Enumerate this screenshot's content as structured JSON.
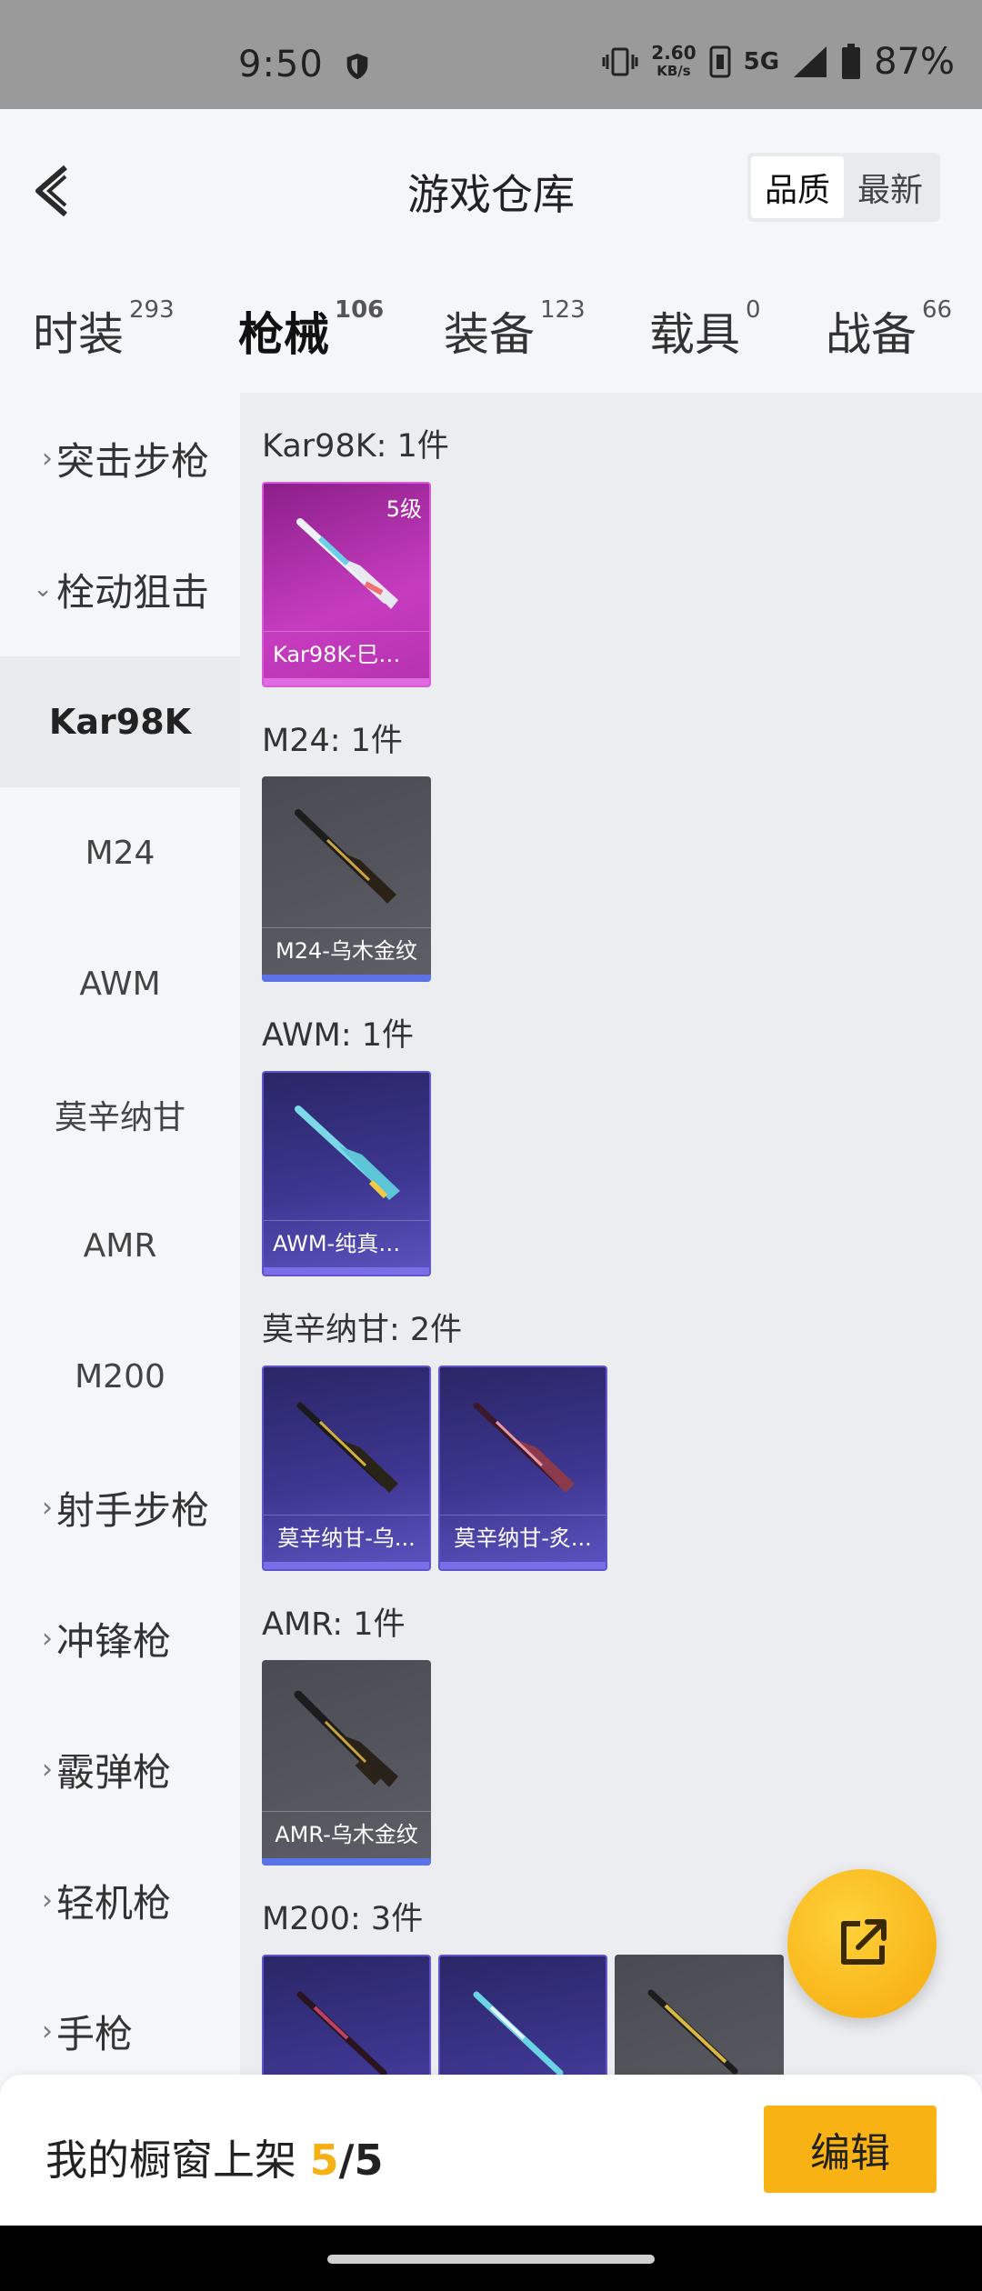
{
  "status_bar": {
    "time": "9:50",
    "net_speed": "2.60",
    "net_unit": "KB/s",
    "network": "5G",
    "battery": "87%"
  },
  "header": {
    "title": "游戏仓库",
    "sort_options": [
      "品质",
      "最新"
    ],
    "active_sort": "品质"
  },
  "tabs": [
    {
      "label": "时装",
      "count": "293"
    },
    {
      "label": "枪械",
      "count": "106",
      "active": true
    },
    {
      "label": "装备",
      "count": "123"
    },
    {
      "label": "载具",
      "count": "0"
    },
    {
      "label": "战备",
      "count": "66"
    }
  ],
  "sidebar": [
    {
      "label": "突击步枪",
      "type": "parent",
      "expanded": false
    },
    {
      "label": "栓动狙击",
      "type": "parent",
      "expanded": true
    },
    {
      "label": "Kar98K",
      "type": "child",
      "selected": true
    },
    {
      "label": "M24",
      "type": "child"
    },
    {
      "label": "AWM",
      "type": "child"
    },
    {
      "label": "莫辛纳甘",
      "type": "child"
    },
    {
      "label": "AMR",
      "type": "child"
    },
    {
      "label": "M200",
      "type": "child"
    },
    {
      "label": "射手步枪",
      "type": "parent",
      "expanded": false
    },
    {
      "label": "冲锋枪",
      "type": "parent",
      "expanded": false
    },
    {
      "label": "霰弹枪",
      "type": "parent",
      "expanded": false
    },
    {
      "label": "轻机枪",
      "type": "parent",
      "expanded": false
    },
    {
      "label": "手枪",
      "type": "parent",
      "expanded": false
    }
  ],
  "groups": [
    {
      "title": "Kar98K: 1件",
      "items": [
        {
          "name": "Kar98K-巳巳...",
          "rarity": "pink",
          "badge": "5级"
        }
      ]
    },
    {
      "title": "M24: 1件",
      "items": [
        {
          "name": "M24-乌木金纹",
          "rarity": "gray"
        }
      ]
    },
    {
      "title": "AWM: 1件",
      "items": [
        {
          "name": "AWM-纯真浪花",
          "rarity": "purple"
        }
      ]
    },
    {
      "title": "莫辛纳甘: 2件",
      "items": [
        {
          "name": "莫辛纳甘-乌...",
          "rarity": "purple"
        },
        {
          "name": "莫辛纳甘-炙...",
          "rarity": "purple"
        }
      ]
    },
    {
      "title": "AMR: 1件",
      "items": [
        {
          "name": "AMR-乌木金纹",
          "rarity": "gray"
        }
      ]
    },
    {
      "title": "M200: 3件",
      "items": [
        {
          "name": "",
          "rarity": "purple"
        },
        {
          "name": "",
          "rarity": "purple"
        },
        {
          "name": "",
          "rarity": "gray"
        }
      ]
    }
  ],
  "bottom_bar": {
    "shelf_label": "我的橱窗上架",
    "shelf_current": "5",
    "shelf_total": "/5",
    "edit_label": "编辑"
  },
  "icons": {
    "back": "back-arrow-icon",
    "share": "share-external-icon",
    "shield": "shield-icon"
  },
  "colors": {
    "accent": "#f9b214",
    "pink_rarity": "#c63cc0",
    "purple_rarity": "#3d3690",
    "gray_rarity": "#5e5e66"
  }
}
